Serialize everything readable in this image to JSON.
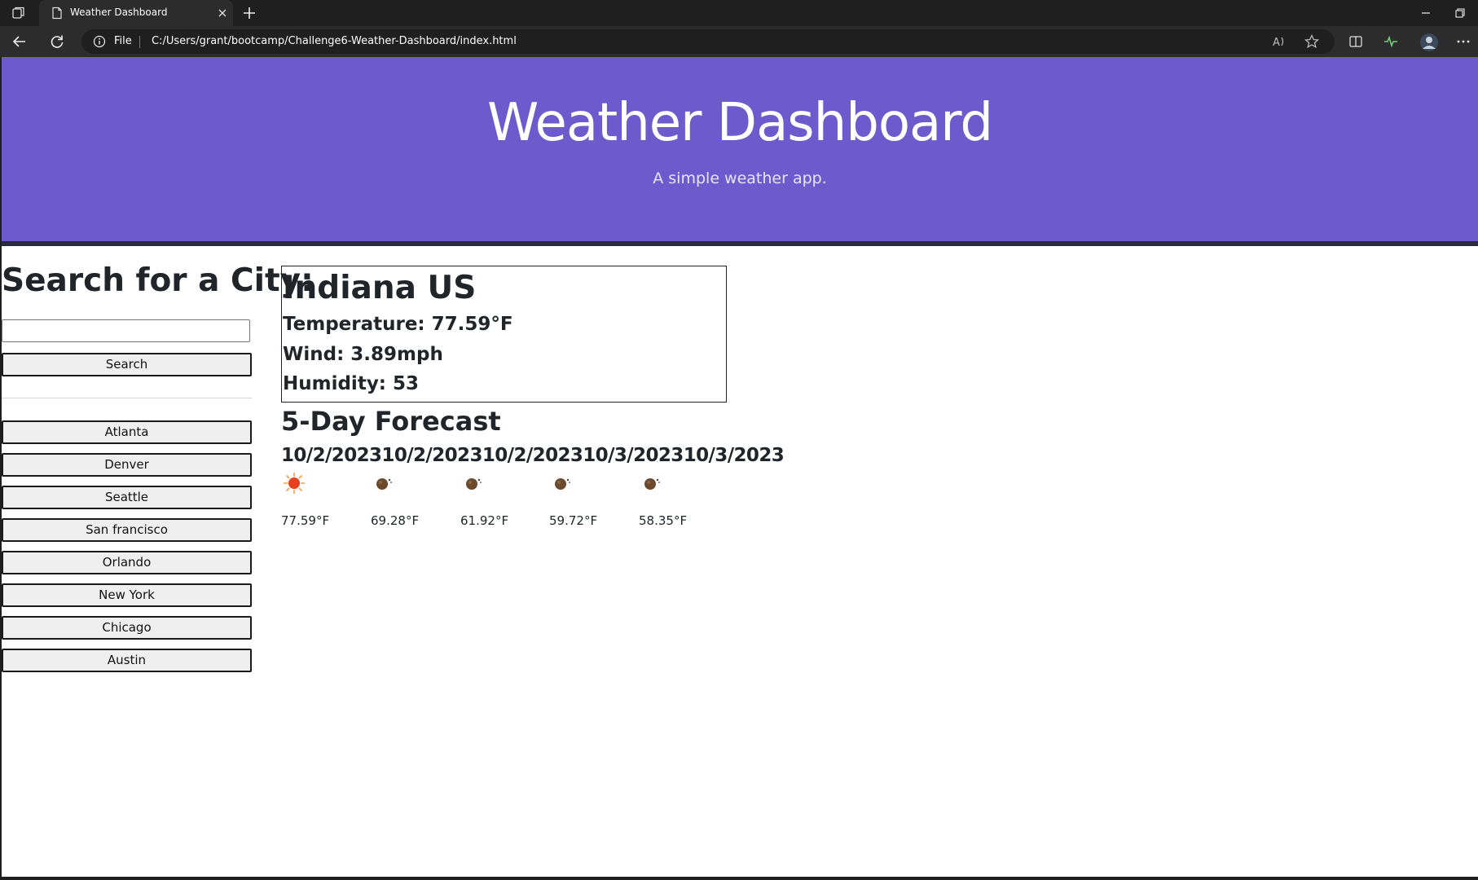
{
  "browser": {
    "tab_title": "Weather Dashboard",
    "scheme_label": "File",
    "url": "C:/Users/grant/bootcamp/Challenge6-Weather-Dashboard/index.html"
  },
  "header": {
    "title": "Weather Dashboard",
    "subtitle": "A simple weather app."
  },
  "sidebar": {
    "heading": "Search for a City:",
    "search_value": "",
    "search_button": "Search",
    "history": [
      "Atlanta",
      "Denver",
      "Seattle",
      "San francisco",
      "Orlando",
      "New York",
      "Chicago",
      "Austin"
    ]
  },
  "current": {
    "city": "Indiana US",
    "temperature": "Temperature: 77.59°F",
    "wind": "Wind: 3.89mph",
    "humidity": "Humidity: 53"
  },
  "forecast": {
    "heading": "5-Day Forecast",
    "dates_line": "10/2/202310/2/202310/2/202310/3/202310/3/2023",
    "days": [
      {
        "icon": "sun-icon",
        "temp": "77.59°F"
      },
      {
        "icon": "moon-icon",
        "temp": "69.28°F"
      },
      {
        "icon": "moon-icon",
        "temp": "61.92°F"
      },
      {
        "icon": "moon-icon",
        "temp": "59.72°F"
      },
      {
        "icon": "moon-icon",
        "temp": "58.35°F"
      }
    ]
  },
  "colors": {
    "header_bg": "#6d5acc",
    "page_bg": "#ffffff",
    "chrome_bg": "#1f1f1f"
  }
}
